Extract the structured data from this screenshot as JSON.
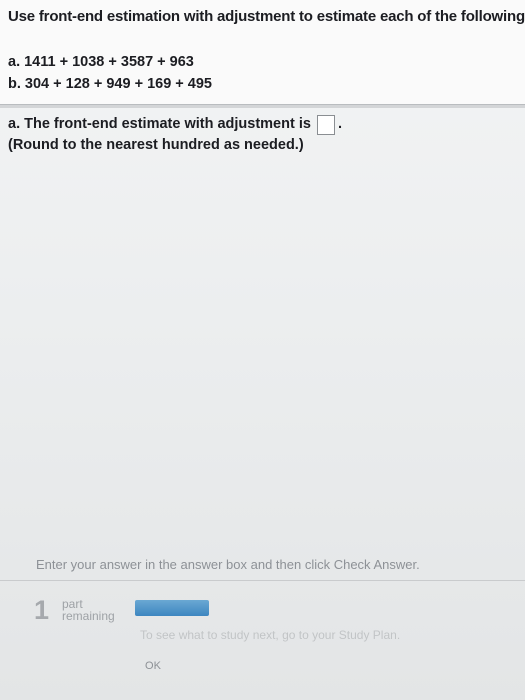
{
  "question": {
    "title": "Use front-end estimation with adjustment to estimate each of the following.",
    "problems": [
      "a. 1411 + 1038 + 3587 + 963",
      "b. 304 + 128 + 949 + 169 + 495"
    ]
  },
  "answer": {
    "prompt": "a. The front-end estimate with adjustment is",
    "value": "",
    "period": ".",
    "note": "(Round to the nearest hundred as needed.)"
  },
  "footer": {
    "instruction": "Enter your answer in the answer box and then click Check Answer.",
    "parts_count": "1",
    "parts_label_1": "part",
    "parts_label_2": "remaining",
    "progress_fraction": 1.0,
    "faded_text": "To see what to study next, go to your Study Plan.",
    "ok_label": "OK"
  },
  "colors": {
    "progress_fill": "#3d86c0",
    "instruction_text": "#8d9196"
  }
}
